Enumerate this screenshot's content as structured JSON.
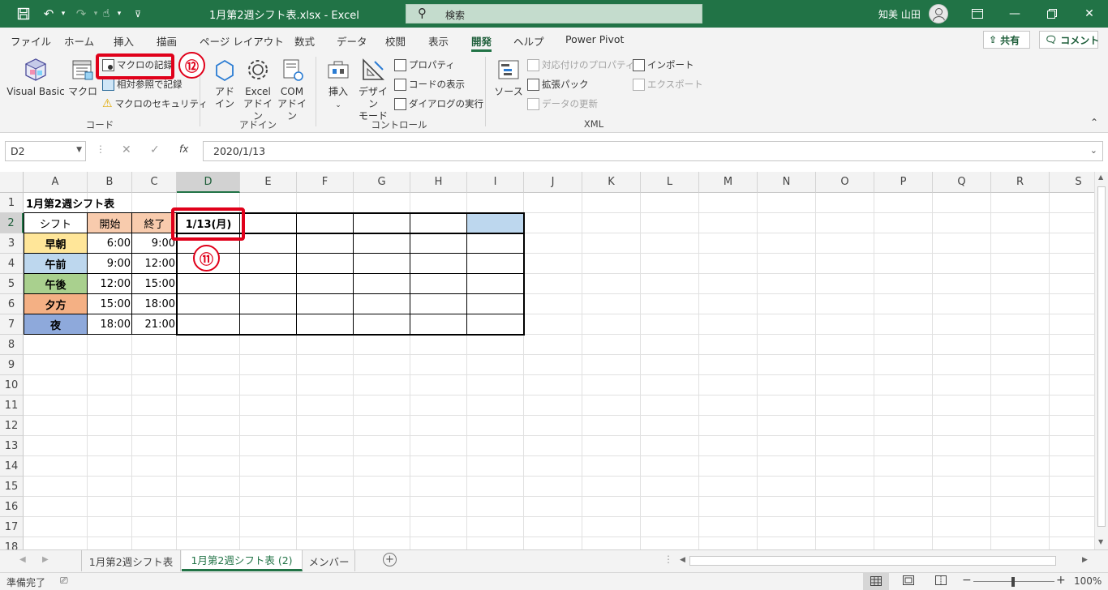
{
  "titlebar": {
    "file_title": "1月第2週シフト表.xlsx  -  Excel",
    "search_placeholder": "検索",
    "user_name": "知美 山田"
  },
  "tabs": [
    "ファイル",
    "ホーム",
    "挿入",
    "描画",
    "ページ レイアウト",
    "数式",
    "データ",
    "校閲",
    "表示",
    "開発",
    "ヘルプ",
    "Power Pivot"
  ],
  "active_tab": "開発",
  "share_label": "共有",
  "comment_label": "コメント",
  "ribbon": {
    "code_group": {
      "label": "コード",
      "visual_basic": "Visual Basic",
      "macro": "マクロ",
      "record_macro": "マクロの記録",
      "relative_ref": "相対参照で記録",
      "macro_security": "マクロのセキュリティ"
    },
    "addin_group": {
      "label": "アドイン",
      "addin_line1": "アド",
      "addin_line2": "イン",
      "excel_addin_line1": "Excel",
      "excel_addin_line2": "アドイン",
      "com_addin_line1": "COM",
      "com_addin_line2": "アドイン"
    },
    "control_group": {
      "label": "コントロール",
      "insert": "挿入",
      "design_line1": "デザイン",
      "design_line2": "モード",
      "properties": "プロパティ",
      "view_code": "コードの表示",
      "run_dialog": "ダイアログの実行"
    },
    "xml_group": {
      "label": "XML",
      "source": "ソース",
      "map_properties": "対応付けのプロパティ",
      "expansion_packs": "拡張パック",
      "refresh_data": "データの更新",
      "import": "インポート",
      "export": "エクスポート"
    }
  },
  "annotations": {
    "step12": "⑫",
    "step11": "⑪"
  },
  "formula_bar": {
    "name_box": "D2",
    "formula": "2020/1/13"
  },
  "columns": [
    "A",
    "B",
    "C",
    "D",
    "E",
    "F",
    "G",
    "H",
    "I",
    "J",
    "K",
    "L",
    "M",
    "N",
    "O",
    "P",
    "Q",
    "R",
    "S"
  ],
  "rows": [
    "1",
    "2",
    "3",
    "4",
    "5",
    "6",
    "7",
    "8",
    "9",
    "10",
    "11",
    "12",
    "13",
    "14",
    "15",
    "16",
    "17",
    "18"
  ],
  "sheet": {
    "title": "1月第2週シフト表",
    "header": {
      "shift": "シフト",
      "start": "開始",
      "end": "終了",
      "date": "1/13(月)"
    },
    "shifts": [
      {
        "name": "早朝",
        "start": "6:00",
        "end": "9:00",
        "color": "#ffe699"
      },
      {
        "name": "午前",
        "start": "9:00",
        "end": "12:00",
        "color": "#bdd7ee"
      },
      {
        "name": "午後",
        "start": "12:00",
        "end": "15:00",
        "color": "#a9d08e"
      },
      {
        "name": "夕方",
        "start": "15:00",
        "end": "18:00",
        "color": "#f4b084"
      },
      {
        "name": "夜",
        "start": "18:00",
        "end": "21:00",
        "color": "#8ea9db"
      }
    ],
    "header_fill": "#f8cbad",
    "i2_fill": "#bdd7ee"
  },
  "sheet_tabs": [
    "1月第2週シフト表",
    "1月第2週シフト表 (2)",
    "メンバー"
  ],
  "active_sheet": "1月第2週シフト表 (2)",
  "status": {
    "ready": "準備完了",
    "zoom": "100%"
  }
}
